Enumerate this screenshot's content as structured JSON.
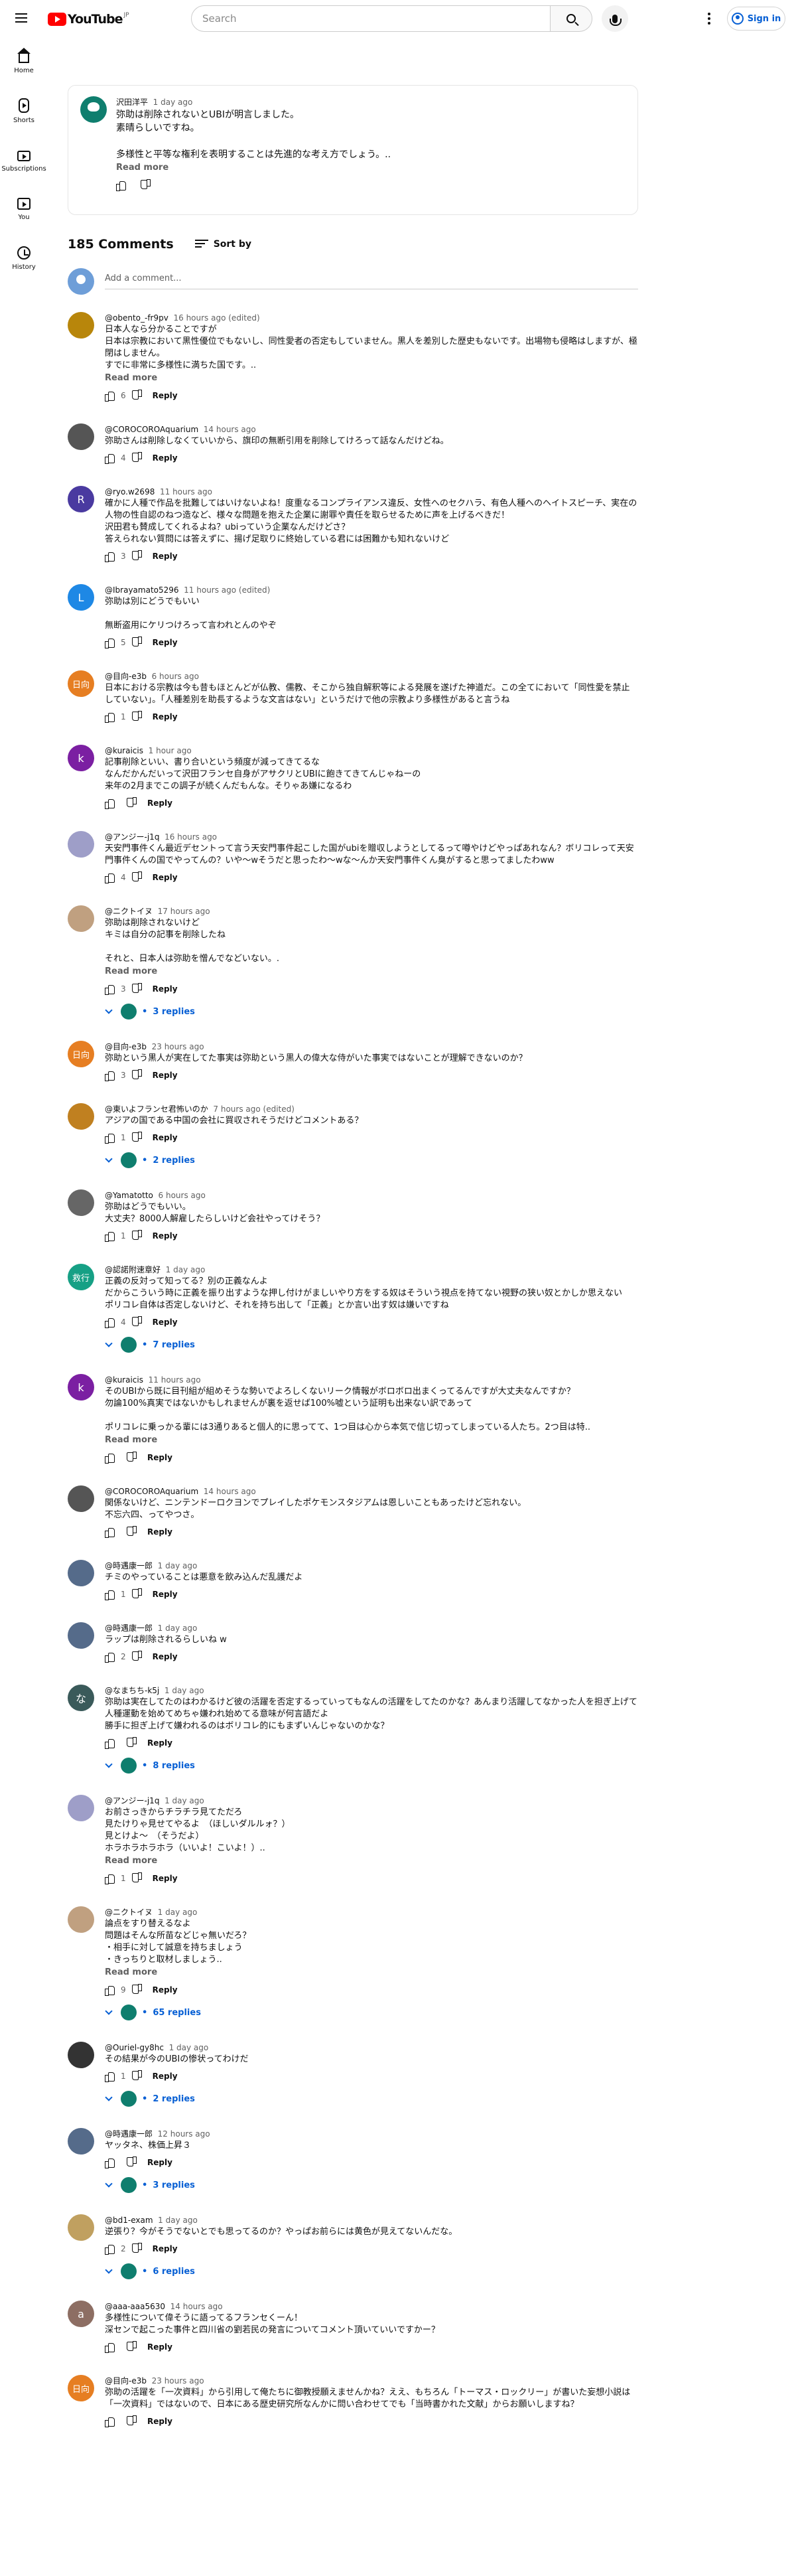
{
  "header": {
    "logo_text": "YouTube",
    "logo_region": "JP",
    "search_placeholder": "Search",
    "signin_label": "Sign in"
  },
  "sidebar": {
    "items": [
      {
        "label": "Home",
        "icon": "home-icon"
      },
      {
        "label": "Shorts",
        "icon": "shorts-icon"
      },
      {
        "label": "Subscriptions",
        "icon": "subscriptions-icon"
      },
      {
        "label": "You",
        "icon": "you-icon"
      },
      {
        "label": "History",
        "icon": "history-icon"
      }
    ]
  },
  "post": {
    "author": "沢田洋平",
    "time": "1 day ago",
    "text": "弥助は削除されないとUBIが明言しました。\n素晴らしいですね。\n\n多様性と平等な権利を表明することは先進的な考え方でしょう。..",
    "read_more": "Read more"
  },
  "comments_header": {
    "count": "185 Comments",
    "sort_label": "Sort by",
    "add_placeholder": "Add a comment..."
  },
  "comments": [
    {
      "author": "@obento_-fr9pv",
      "time": "16 hours ago (edited)",
      "text": "日本人なら分かることですが\n日本は宗教において黒性優位でもないし、同性愛者の否定もしていません。黒人を差別した歴史もないです。出場物も侵略はしますが、極閉はしません。\nすでに非常に多様性に満ちた国です。..",
      "read_more": "Read more",
      "likes": "6",
      "color": "#b8860b",
      "initial": ""
    },
    {
      "author": "@COROCOROAquarium",
      "time": "14 hours ago",
      "text": "弥助さんは削除しなくていいから、旗印の無断引用を削除してけろって話なんだけどね。",
      "read_more": "",
      "likes": "4",
      "color": "#555555",
      "initial": ""
    },
    {
      "author": "@ryo.w2698",
      "time": "11 hours ago",
      "text": "確かに人種で作品を批難してはいけないよね！度重なるコンプライアンス違反、女性へのセクハラ、有色人種へのヘイトスピーチ、実在の人物の性自認のねつ造など、様々な問題を抱えた企業に謝罪や責任を取らせるために声を上げるべきだ！\n沢田君も賛成してくれるよね？ubiっていう企業なんだけどさ？\n答えられない質問には答えずに、揚げ足取りに終始している君には困難かも知れないけど",
      "read_more": "",
      "likes": "3",
      "color": "#4a3aa0",
      "initial": "R"
    },
    {
      "author": "@Ibrayamato5296",
      "time": "11 hours ago (edited)",
      "text": "弥助は別にどうでもいい\n\n無断盗用にケリつけろって言われとんのやぞ",
      "read_more": "",
      "likes": "5",
      "color": "#1e88e5",
      "initial": "L"
    },
    {
      "author": "@目向-e3b",
      "time": "6 hours ago",
      "text": "日本における宗教は今も昔もほとんどが仏教、儒教、そこから独自解釈等による発展を遂げた神道だ。この全てにおいて「同性愛を禁止していない」。「人種差別を助長するような文言はない」というだけで他の宗教より多様性があると言うね",
      "read_more": "",
      "likes": "1",
      "color": "#e67e22",
      "initial": "日向"
    },
    {
      "author": "@kuraicis",
      "time": "1 hour ago",
      "text": "記事削除といい、書り合いという頻度が減ってきてるな\nなんだかんだいって沢田フランセ自身がアサクリとUBIに飽きてきてんじゃねーの\n来年の2月までこの調子が続くんだもんな。そりゃあ嫌になるわ",
      "read_more": "",
      "likes": "",
      "color": "#7b1fa2",
      "initial": "k"
    },
    {
      "author": "@アンジー-j1q",
      "time": "16 hours ago",
      "text": "天安門事件くん最近デセントって言う天安門事件起こした国がubiを贈収しようとしてるって噂やけどやっぱあれなん？ボリコレって天安門事件くんの国でやってんの？いや〜wそうだと思ったわ〜wな〜んか天安門事件くん臭がすると思ってましたわww",
      "read_more": "",
      "likes": "4",
      "color": "#9e9ec8",
      "initial": ""
    },
    {
      "author": "@ニクトイヌ",
      "time": "17 hours ago",
      "text": "弥助は削除されないけど\nキミは自分の記事を削除したね\n\nそれと、日本人は弥助を憎んでなどいない。.",
      "read_more": "Read more",
      "likes": "3",
      "color": "#c0a080",
      "initial": "",
      "replies": "3 replies"
    },
    {
      "author": "@目向-e3b",
      "time": "23 hours ago",
      "text": "弥助という黒人が実在してた事実は弥助という黒人の偉大な侍がいた事実ではないことが理解できないのか？",
      "read_more": "",
      "likes": "3",
      "color": "#e67e22",
      "initial": "日向"
    },
    {
      "author": "@東いよフランセ君怖いのか",
      "time": "7 hours ago (edited)",
      "text": "アジアの国である中国の会社に買収されそうだけどコメントある？",
      "read_more": "",
      "likes": "1",
      "color": "#c08020",
      "initial": "",
      "replies": "2 replies"
    },
    {
      "author": "@Yamatotto",
      "time": "6 hours ago",
      "text": "弥助はどうでもいい。\n大丈夫？8000人解雇したらしいけど会社やってけそう？",
      "read_more": "",
      "likes": "1",
      "color": "#666666",
      "initial": ""
    },
    {
      "author": "@認諾附速章好",
      "time": "1 day ago",
      "text": "正義の反対って知ってる？別の正義なんよ\nだからこういう時に正義を振り出すような押し付けがましいやり方をする奴はそういう視点を持てない視野の狭い奴とかしか思えない\nポリコレ自体は否定しないけど、それを持ち出して「正義」とか言い出す奴は嫌いですね",
      "read_more": "",
      "likes": "4",
      "color": "#16a085",
      "initial": "救行",
      "replies": "7 replies"
    },
    {
      "author": "@kuraicis",
      "time": "11 hours ago",
      "text": "そのUBIから既に目刊組が組めそうな勢いでよろしくないリーク情報がボロボロ出まくってるんですが大丈夫なんですか？\n勿論100%真実ではないかもしれませんが裏を返せば100%嘘という証明も出来ない訳であって\n\nポリコレに乗っかる輩には3通りあると個人的に思ってて、1つ目は心から本気で信じ切ってしまっている人たち。2つ目は特..",
      "read_more": "Read more",
      "likes": "",
      "color": "#7b1fa2",
      "initial": "k"
    },
    {
      "author": "@COROCOROAquarium",
      "time": "14 hours ago",
      "text": "関係ないけど、ニンテンドーロクヨンでプレイしたポケモンスタジアムは恩しいこともあったけど忘れない。\n不忘六四、ってやつさ。",
      "read_more": "",
      "likes": "",
      "color": "#555555",
      "initial": ""
    },
    {
      "author": "@時遇康一郎",
      "time": "1 day ago",
      "text": "チミのやっていることは悪意を飲み込んだ乱護だよ",
      "read_more": "",
      "likes": "1",
      "color": "#556b8a",
      "initial": ""
    },
    {
      "author": "@時遇康一郎",
      "time": "1 day ago",
      "text": "ラップは削除されるらしいね w",
      "read_more": "",
      "likes": "2",
      "color": "#556b8a",
      "initial": ""
    },
    {
      "author": "@なまちち-k5j",
      "time": "1 day ago",
      "text": "弥助は実在してたのはわかるけど彼の活躍を否定するっていってもなんの活躍をしてたのかな？あんまり活躍してなかった人を担ぎ上げて人種運動を始めてめちゃ嫌われ始めてる意味が何言語だよ\n勝手に担ぎ上げて嫌われるのはボリコレ的にもまずいんじゃないのかな？",
      "read_more": "",
      "likes": "",
      "color": "#3a5a5a",
      "initial": "な",
      "replies": "8 replies"
    },
    {
      "author": "@アンジー-j1q",
      "time": "1 day ago",
      "text": "お前さっきからチラチラ見てただろ\n見たけりゃ見せてやるよ　（ほしいダルルォ？）\n見とけよ〜　（そうだよ）\nホラホラホラホラ（いいよ！こいよ！）..",
      "read_more": "Read more",
      "likes": "1",
      "color": "#9e9ec8",
      "initial": ""
    },
    {
      "author": "@ニクトイヌ",
      "time": "1 day ago",
      "text": "論点をすり替えるなよ\n問題はそんな所苗などじゃ無いだろ？\n・相手に対して誠意を持ちましょう\n・きっちりと取材しましょう..",
      "read_more": "Read more",
      "likes": "9",
      "color": "#c0a080",
      "initial": "",
      "replies": "65 replies"
    },
    {
      "author": "@Ouriel-gy8hc",
      "time": "1 day ago",
      "text": "その結果が今のUBIの惨状ってわけだ",
      "read_more": "",
      "likes": "1",
      "color": "#333333",
      "initial": "",
      "replies": "2 replies"
    },
    {
      "author": "@時遇康一郎",
      "time": "12 hours ago",
      "text": "ヤッタネ、株価上昇３",
      "read_more": "",
      "likes": "",
      "color": "#556b8a",
      "initial": "",
      "replies": "3 replies"
    },
    {
      "author": "@bd1-exam",
      "time": "1 day ago",
      "text": "逆張り？今がそうでないとでも思ってるのか？やっぱお前らには黄色が見えてないんだな。",
      "read_more": "",
      "likes": "2",
      "color": "#c0a060",
      "initial": "",
      "replies": "6 replies"
    },
    {
      "author": "@aaa-aaa5630",
      "time": "14 hours ago",
      "text": "多様性について偉そうに語ってるフランセくーん！\n深センで起こった事件と四川省の劉若民の発言についてコメント頂いていいですかー？",
      "read_more": "",
      "likes": "",
      "color": "#8d6e63",
      "initial": "a"
    },
    {
      "author": "@目向-e3b",
      "time": "23 hours ago",
      "text": "弥助の活躍を「一次資料」から引用して俺たちに御教授願えませんかね？ええ、もちろん「トーマス・ロックリー」が書いた妄想小説は「一次資料」ではないので、日本にある歴史研究所なんかに問い合わせてでも「当時書かれた文献」からお願いしますね？",
      "read_more": "",
      "likes": "",
      "color": "#e67e22",
      "initial": "日向"
    }
  ],
  "labels": {
    "reply": "Reply"
  }
}
